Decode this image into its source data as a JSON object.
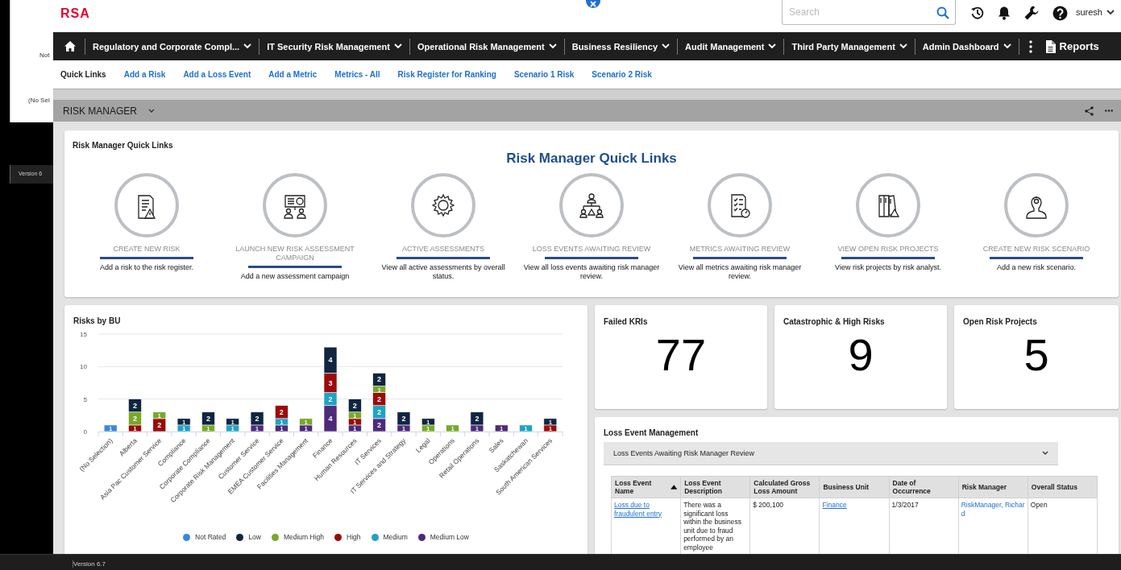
{
  "background_app": {
    "texts": [
      "Not",
      "(No Sel"
    ],
    "status_bar": "Version 6"
  },
  "header": {
    "logo": "RSA",
    "search": {
      "placeholder": "Search"
    },
    "user": "suresh"
  },
  "nav": {
    "items": [
      {
        "label": "Regulatory and Corporate Compl...",
        "kind": "menu"
      },
      {
        "label": "IT Security Risk Management",
        "kind": "menu"
      },
      {
        "label": "Operational Risk Management",
        "kind": "menu"
      },
      {
        "label": "Business Resiliency",
        "kind": "menu"
      },
      {
        "label": "Audit Management",
        "kind": "menu"
      },
      {
        "label": "Third Party Management",
        "kind": "menu"
      },
      {
        "label": "Admin Dashboard",
        "kind": "menu"
      },
      {
        "label": "Reports",
        "kind": "report"
      }
    ]
  },
  "quick_links": {
    "label": "Quick Links",
    "links": [
      "Add a Risk",
      "Add a Loss Event",
      "Add a Metric",
      "Metrics - All",
      "Risk Register for Ranking",
      "Scenario 1 Risk",
      "Scenario 2 Risk"
    ]
  },
  "section": {
    "title": "RISK MANAGER"
  },
  "quick_links_card": {
    "title": "Risk Manager Quick Links",
    "heading": "Risk Manager Quick Links",
    "items": [
      {
        "label": "CREATE NEW RISK",
        "description": "Add a risk to the risk register."
      },
      {
        "label": "LAUNCH NEW RISK ASSESSMENT CAMPAIGN",
        "description": "Add a new assessment campaign"
      },
      {
        "label": "ACTIVE ASSESSMENTS",
        "description": "View all active assessments by overall status."
      },
      {
        "label": "LOSS EVENTS AWAITING REVIEW",
        "description": "View all loss events awaiting risk manager review."
      },
      {
        "label": "METRICS AWAITING REVIEW",
        "description": "View all metrics awaiting risk manager review."
      },
      {
        "label": "VIEW OPEN RISK PROJECTS",
        "description": "View risk projects by risk analyst."
      },
      {
        "label": "CREATE NEW RISK SCENARIO",
        "description": "Add a new risk scenario."
      }
    ]
  },
  "risks_by_bu": {
    "title": "Risks by BU",
    "chart_data": {
      "type": "bar",
      "stacked": true,
      "data_labels": true,
      "ylim": [
        0,
        15
      ],
      "yticks": [
        0,
        5,
        10,
        15
      ],
      "categories": [
        "(No Selection)",
        "Alberta",
        "Asia Pac Customer Service",
        "Compliance",
        "Corporate Compliance",
        "Corporate Risk Management",
        "Customer Service",
        "EMEA Customer Service",
        "Facilities Management",
        "Finance",
        "Human Resources",
        "IT Services",
        "IT Services and Strategy",
        "Legal",
        "Operations",
        "Retail Operations",
        "Sales",
        "Saskatchewan",
        "South American Services"
      ],
      "series": [
        {
          "name": "Not Rated",
          "color": "#3a87e0",
          "values": [
            1,
            null,
            null,
            null,
            null,
            null,
            null,
            null,
            null,
            null,
            null,
            null,
            null,
            null,
            null,
            null,
            null,
            null,
            null
          ]
        },
        {
          "name": "Low",
          "color": "#0f2540",
          "values": [
            null,
            2,
            null,
            1,
            2,
            1,
            2,
            null,
            null,
            4,
            2,
            2,
            2,
            1,
            null,
            2,
            null,
            null,
            1
          ]
        },
        {
          "name": "Medium High",
          "color": "#77a82a",
          "values": [
            null,
            2,
            1,
            null,
            1,
            null,
            null,
            null,
            1,
            null,
            1,
            1,
            null,
            1,
            1,
            null,
            null,
            null,
            null
          ]
        },
        {
          "name": "High",
          "color": "#9b0a0a",
          "values": [
            null,
            1,
            2,
            null,
            null,
            null,
            null,
            2,
            null,
            3,
            1,
            2,
            null,
            null,
            null,
            null,
            null,
            null,
            1
          ]
        },
        {
          "name": "Medium",
          "color": "#1fa3c4",
          "values": [
            null,
            null,
            null,
            1,
            null,
            1,
            null,
            1,
            null,
            2,
            null,
            2,
            null,
            null,
            null,
            null,
            null,
            1,
            null
          ]
        },
        {
          "name": "Medium Low",
          "color": "#4e2a7a",
          "values": [
            null,
            null,
            null,
            null,
            null,
            null,
            1,
            1,
            1,
            4,
            1,
            2,
            1,
            null,
            null,
            1,
            1,
            null,
            null
          ]
        }
      ]
    }
  },
  "kpis": [
    {
      "title": "Failed KRIs",
      "value": "77"
    },
    {
      "title": "Catastrophic & High Risks",
      "value": "9"
    },
    {
      "title": "Open Risk Projects",
      "value": "5"
    }
  ],
  "loss_events": {
    "title": "Loss Event Management",
    "filter": "Loss Events Awaiting Risk Manager Review",
    "table": {
      "columns": [
        {
          "label": "Loss Event Name",
          "sorted": true
        },
        {
          "label": "Loss Event Description",
          "sorted": false
        },
        {
          "label": "Calculated Gross Loss Amount",
          "sorted": false
        },
        {
          "label": "Business Unit",
          "sorted": false
        },
        {
          "label": "Date of Occurrence",
          "sorted": false
        },
        {
          "label": "Risk Manager",
          "sorted": false
        },
        {
          "label": "Overall Status",
          "sorted": false
        }
      ],
      "rows": [
        {
          "cells": [
            {
              "text": "Loss due to fraudulent entry",
              "kind": "link"
            },
            {
              "text": "There was a significant loss within the business unit due to fraud performed by an employee",
              "kind": "text"
            },
            {
              "text": "$ 200,100",
              "kind": "text"
            },
            {
              "text": "Finance",
              "kind": "link"
            },
            {
              "text": "1/3/2017",
              "kind": "text"
            },
            {
              "text": "RiskManager, Richard",
              "kind": "user"
            },
            {
              "text": "Open",
              "kind": "text"
            }
          ]
        }
      ]
    }
  },
  "footer": {
    "version": "Version 6.7"
  }
}
